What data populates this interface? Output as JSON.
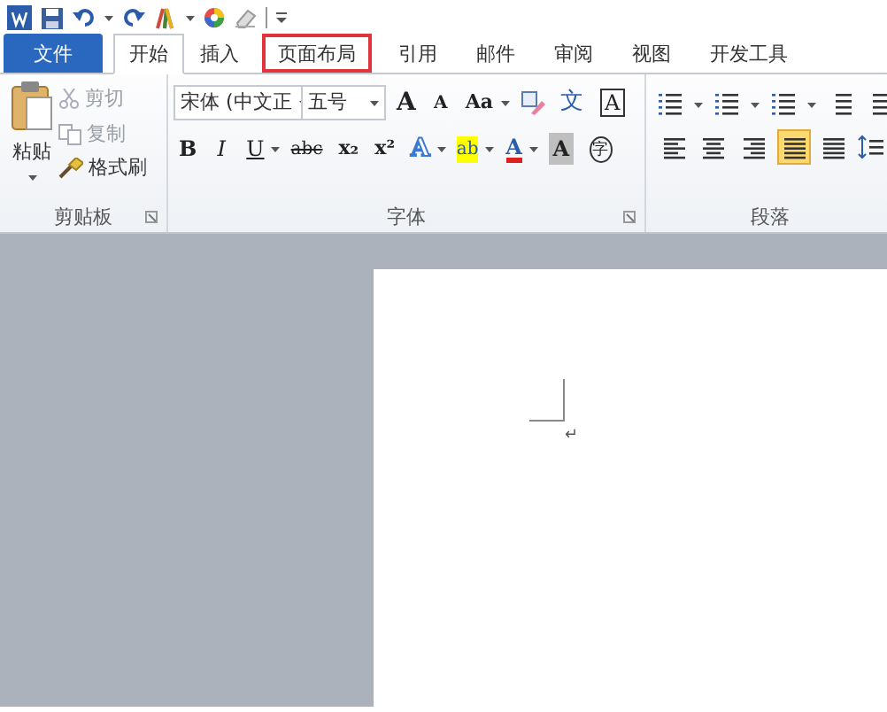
{
  "tabs": [
    {
      "label": "文件",
      "kind": "file",
      "selected": false,
      "highlighted": false
    },
    {
      "label": "开始",
      "kind": "tab",
      "selected": true,
      "highlighted": false
    },
    {
      "label": "插入",
      "kind": "tab",
      "selected": false,
      "highlighted": false
    },
    {
      "label": "页面布局",
      "kind": "tab",
      "selected": false,
      "highlighted": true
    },
    {
      "label": "引用",
      "kind": "tab",
      "selected": false,
      "highlighted": false
    },
    {
      "label": "邮件",
      "kind": "tab",
      "selected": false,
      "highlighted": false
    },
    {
      "label": "审阅",
      "kind": "tab",
      "selected": false,
      "highlighted": false
    },
    {
      "label": "视图",
      "kind": "tab",
      "selected": false,
      "highlighted": false
    },
    {
      "label": "开发工具",
      "kind": "tab",
      "selected": false,
      "highlighted": false
    }
  ],
  "clipboard": {
    "paste": "粘贴",
    "cut": {
      "label": "剪切",
      "disabled": true
    },
    "copy": {
      "label": "复制",
      "disabled": true
    },
    "format_painter": {
      "label": "格式刷",
      "disabled": false
    },
    "group_label": "剪贴板"
  },
  "font": {
    "font_name": "宋体 (中文正",
    "font_size": "五号",
    "row1": [
      {
        "label": "A",
        "kind": "grow"
      },
      {
        "label": "A",
        "kind": "shrink"
      },
      {
        "label": "Aa",
        "kind": "case"
      },
      {
        "kind": "clear"
      },
      {
        "label": "文",
        "kind": "phonetic"
      },
      {
        "label": "A",
        "kind": "border"
      }
    ],
    "row2": [
      {
        "label": "B",
        "kind": "bold"
      },
      {
        "label": "I",
        "kind": "italic"
      },
      {
        "label": "U",
        "kind": "underline"
      },
      {
        "label": "abc",
        "kind": "strike"
      },
      {
        "label": "x₂",
        "kind": "sub"
      },
      {
        "label": "x²",
        "kind": "sup"
      },
      {
        "label": "A",
        "kind": "effects"
      },
      {
        "label": "ab",
        "kind": "highlight"
      },
      {
        "label": "A",
        "kind": "color"
      },
      {
        "label": "A",
        "kind": "shading"
      },
      {
        "label": "字",
        "kind": "enclose"
      }
    ],
    "group_label": "字体"
  },
  "paragraph": {
    "alignment": [
      {
        "kind": "left",
        "selected": false
      },
      {
        "kind": "center",
        "selected": false
      },
      {
        "kind": "right",
        "selected": false
      },
      {
        "kind": "justify",
        "selected": true
      },
      {
        "kind": "distribute",
        "selected": false
      }
    ],
    "group_label": "段落"
  },
  "document": {
    "paragraph_mark": "↵"
  }
}
